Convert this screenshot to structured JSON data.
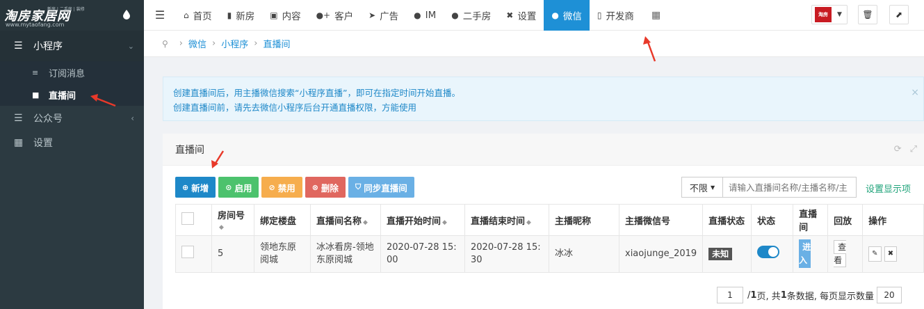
{
  "logo": {
    "text": "淘房家居网",
    "tagline": "新房 | 二手房 | 装修",
    "url": "www.mytaofang.com"
  },
  "sidebar": {
    "groups": [
      {
        "label": "小程序",
        "items": [
          {
            "label": "订阅消息"
          },
          {
            "label": "直播间"
          }
        ]
      },
      {
        "label": "公众号"
      },
      {
        "label": "设置"
      }
    ]
  },
  "topnav": {
    "items": [
      {
        "label": "首页",
        "icon": "home-icon"
      },
      {
        "label": "新房",
        "icon": "building-icon"
      },
      {
        "label": "内容",
        "icon": "content-icon"
      },
      {
        "label": "客户",
        "icon": "user-plus-icon"
      },
      {
        "label": "广告",
        "icon": "paper-plane-icon"
      },
      {
        "label": "IM",
        "icon": "chat-bubble-icon"
      },
      {
        "label": "二手房",
        "icon": "user-icon"
      },
      {
        "label": "设置",
        "icon": "tools-icon"
      },
      {
        "label": "微信",
        "icon": "wechat-icon",
        "active": true
      },
      {
        "label": "开发商",
        "icon": "tower-icon"
      }
    ],
    "avatar_text": "淘房"
  },
  "breadcrumb": {
    "items": [
      "微信",
      "小程序",
      "直播间"
    ]
  },
  "alert": {
    "line1": "创建直播间后，用主播微信搜索“小程序直播”，即可在指定时间开始直播。",
    "line2": "创建直播间前，请先去微信小程序后台开通直播权限，方能使用"
  },
  "panel": {
    "title": "直播间",
    "buttons": {
      "add": "新增",
      "enable": "启用",
      "disable": "禁用",
      "delete": "删除",
      "sync": "同步直播间"
    },
    "filter": {
      "select": "不限",
      "placeholder": "请输入直播间名称/主播名称/主",
      "settings_link": "设置显示项"
    }
  },
  "table": {
    "headers": [
      "房间号",
      "绑定楼盘",
      "直播间名称",
      "直播开始时间",
      "直播结束时间",
      "主播昵称",
      "主播微信号",
      "直播状态",
      "状态",
      "直播间",
      "回放",
      "操作"
    ],
    "rows": [
      {
        "room_no": "5",
        "property": "领地东原阅城",
        "name": "冰冰看房-领地东原阅城",
        "start": "2020-07-28 15:00",
        "end": "2020-07-28 15:30",
        "anchor": "冰冰",
        "wechat": "xiaojunge_2019",
        "live_status": "未知",
        "enabled": true,
        "enter_label": "进入",
        "replay_label": "查看"
      }
    ]
  },
  "pager": {
    "current": "1",
    "total_pages": "1",
    "total_records": "1",
    "page_size": "20",
    "text_pages_prefix": "/ ",
    "text_pages_suffix": " 页, 共 ",
    "text_records_suffix": " 条数据, 每页显示数量"
  },
  "colors": {
    "sidebar": "#2c3a41",
    "accent": "#1e90d6",
    "annotation": "#e8392a"
  }
}
